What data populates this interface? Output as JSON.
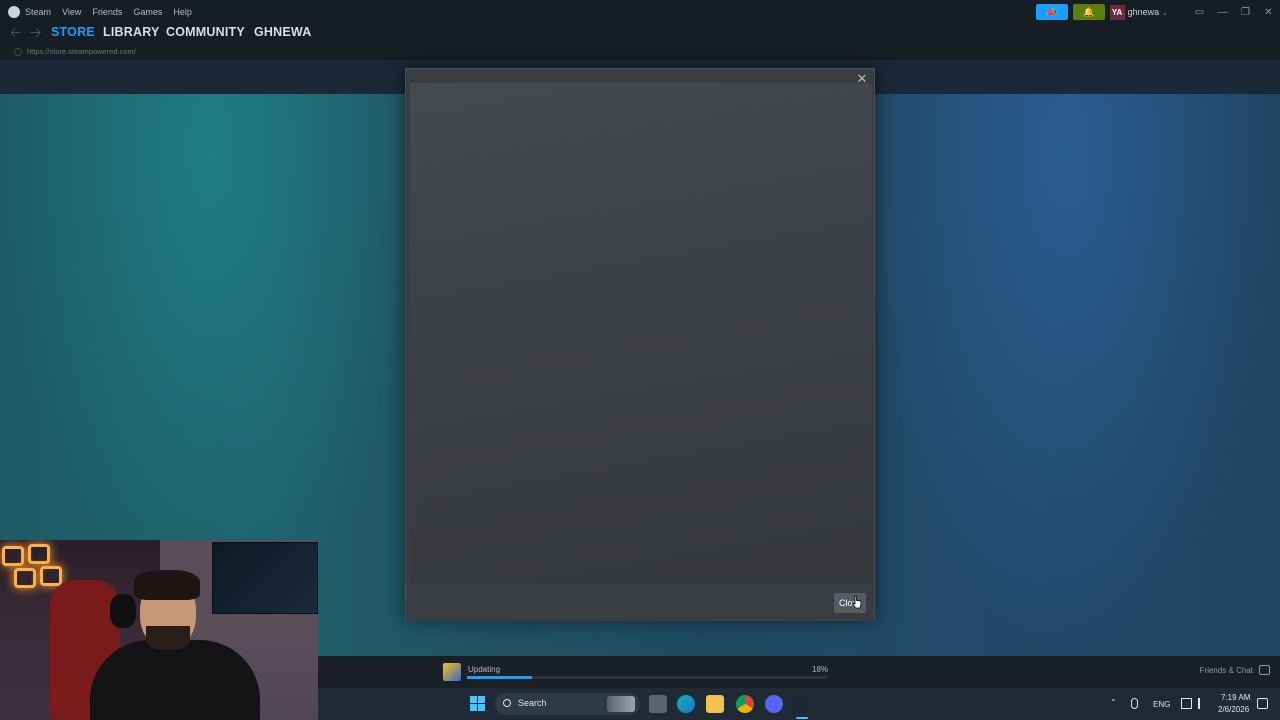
{
  "menu": {
    "items": [
      "Steam",
      "View",
      "Friends",
      "Games",
      "Help"
    ]
  },
  "header": {
    "avatar_text": "YA",
    "username": "ghnewa",
    "username_caret": "⌄"
  },
  "nav": {
    "tabs": [
      "STORE",
      "LIBRARY",
      "COMMUNITY",
      "GHNEWA"
    ],
    "active_tab": "STORE",
    "url": "https://store.steampowered.com/"
  },
  "modal": {
    "close_x": "✕",
    "close_button_label": "Clos"
  },
  "download": {
    "status": "Updating",
    "percent_label": "18%",
    "progress": 0.18
  },
  "friends": {
    "label": "Friends & Chat"
  },
  "taskbar": {
    "search_label": "Search",
    "language": "ENG",
    "time": "7:19 AM",
    "date": "2/6/2026"
  },
  "colors": {
    "accent": "#1a9fff",
    "notify_green": "#5c7e10",
    "background": "#171d25"
  },
  "icons": {
    "back": "back-arrow-icon",
    "forward": "forward-arrow-icon",
    "announce": "megaphone-icon",
    "notify": "bell-icon",
    "close": "close-icon"
  }
}
